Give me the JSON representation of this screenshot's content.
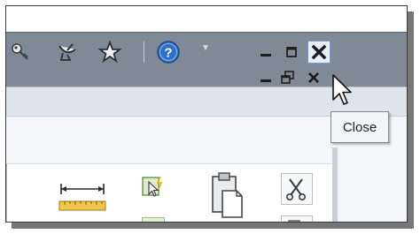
{
  "window": {
    "controls": {
      "close_tooltip": "Close"
    },
    "toolbar_icons": [
      "key-icon",
      "satellite-icon",
      "star-icon",
      "help-icon",
      "chevron-down-icon"
    ],
    "window_buttons": [
      "minimize-icon",
      "maximize-icon",
      "close-icon"
    ],
    "doc_buttons": [
      "minimize-icon",
      "restore-icon",
      "close-icon"
    ]
  },
  "ribbon": {
    "tools": [
      "measure-icon",
      "select-icon",
      "paste-icon",
      "cut-icon",
      "copy-icon"
    ]
  },
  "colors": {
    "titlebar": "#7f8a96",
    "ribbon": "#f4f6f9",
    "accent": "#6f9fd6"
  }
}
